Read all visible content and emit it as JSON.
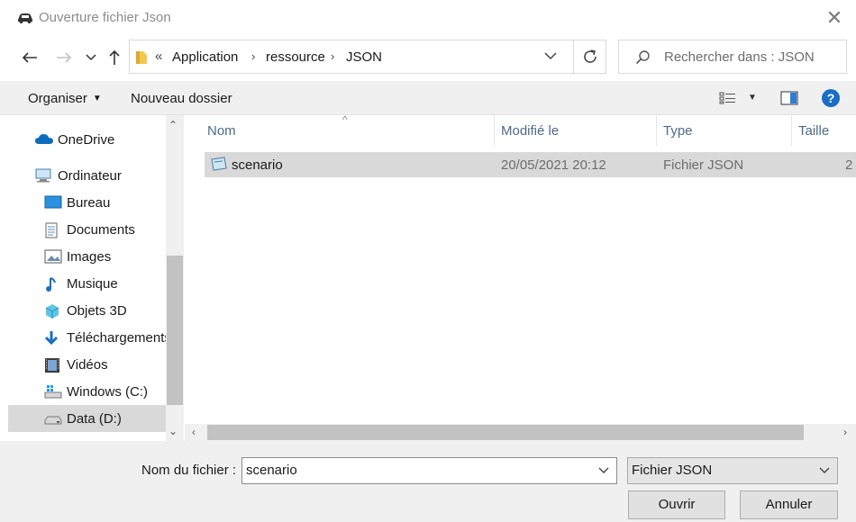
{
  "window": {
    "title": "Ouverture fichier Json",
    "close_glyph": "✕"
  },
  "address": {
    "overflow": "«",
    "crumbs": [
      "Application",
      "ressource",
      "JSON"
    ]
  },
  "search": {
    "placeholder": "Rechercher dans : JSON"
  },
  "toolbar": {
    "organize": "Organiser",
    "new_folder": "Nouveau dossier",
    "help": "?"
  },
  "nav": {
    "items": [
      {
        "label": "OneDrive",
        "icon": "cloud-icon"
      },
      {
        "label": "Ordinateur",
        "icon": "computer-icon"
      },
      {
        "label": "Bureau",
        "icon": "desktop-icon"
      },
      {
        "label": "Documents",
        "icon": "documents-icon"
      },
      {
        "label": "Images",
        "icon": "pictures-icon"
      },
      {
        "label": "Musique",
        "icon": "music-icon"
      },
      {
        "label": "Objets 3D",
        "icon": "objects3d-icon"
      },
      {
        "label": "Téléchargements",
        "icon": "downloads-icon"
      },
      {
        "label": "Vidéos",
        "icon": "videos-icon"
      },
      {
        "label": "Windows (C:)",
        "icon": "drive-windows-icon"
      },
      {
        "label": "Data (D:)",
        "icon": "drive-icon"
      }
    ],
    "selected": "Data (D:)"
  },
  "files": {
    "columns": [
      "Nom",
      "Modifié le",
      "Type",
      "Taille"
    ],
    "rows": [
      {
        "name": "scenario",
        "modified": "20/05/2021 20:12",
        "type": "Fichier JSON",
        "size": "2"
      }
    ]
  },
  "footer": {
    "filename_label": "Nom du fichier :",
    "filename_value": "scenario",
    "filetype": "Fichier JSON",
    "open": "Ouvrir",
    "cancel": "Annuler"
  },
  "colors": {
    "selection": "#d9d9d9",
    "column_header": "#4d6a8a",
    "help_blue": "#1a6fc4"
  }
}
